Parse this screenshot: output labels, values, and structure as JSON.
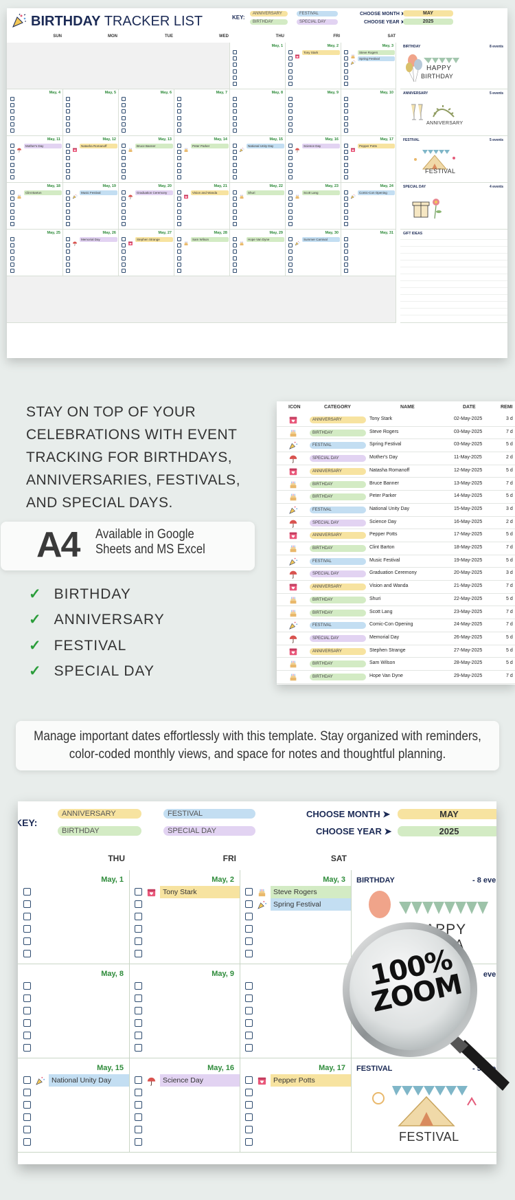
{
  "sheet1": {
    "title_bold": "BIRTHDAY",
    "title_rest": " TRACKER LIST",
    "key_label": "KEY:",
    "key": {
      "anniversary": "ANNIVERSARY",
      "festival": "FESTIVAL",
      "birthday": "BIRTHDAY",
      "special_day": "SPECIAL DAY"
    },
    "choose_month_label": "CHOOSE MONTH ➤",
    "choose_year_label": "CHOOSE YEAR ➤",
    "month": "MAY",
    "year": "2025",
    "day_headers": [
      "SUN",
      "MON",
      "TUE",
      "WED",
      "THU",
      "FRI",
      "SAT"
    ],
    "sidebar": [
      {
        "label": "BIRTHDAY",
        "count": "8 events"
      },
      {
        "label": "ANNIVERSARY",
        "count": "5 events"
      },
      {
        "label": "FESTIVAL",
        "count": "5 events"
      },
      {
        "label": "SPECIAL DAY",
        "count": "4 events"
      },
      {
        "label": "GIFT IDEAS",
        "count": ""
      }
    ],
    "art_text": {
      "happy": "HAPPY",
      "birthday": "BIRTHDAY",
      "anniversary": "ANNIVERSARY",
      "festival": "FESTIVAL"
    },
    "weeks": [
      [
        null,
        null,
        null,
        null,
        {
          "date": "May, 1",
          "events": []
        },
        {
          "date": "May, 2",
          "events": [
            {
              "name": "Tony Stark",
              "cat": "anniversary"
            }
          ]
        },
        {
          "date": "May, 3",
          "events": [
            {
              "name": "Steve Rogers",
              "cat": "birthday"
            },
            {
              "name": "Spring Festival",
              "cat": "festival"
            }
          ]
        }
      ],
      [
        {
          "date": "May, 4",
          "events": []
        },
        {
          "date": "May, 5",
          "events": []
        },
        {
          "date": "May, 6",
          "events": []
        },
        {
          "date": "May, 7",
          "events": []
        },
        {
          "date": "May, 8",
          "events": []
        },
        {
          "date": "May, 9",
          "events": []
        },
        {
          "date": "May, 10",
          "events": []
        }
      ],
      [
        {
          "date": "May, 11",
          "events": [
            {
              "name": "Mother's Day",
              "cat": "special"
            }
          ]
        },
        {
          "date": "May, 12",
          "events": [
            {
              "name": "Natasha Romanoff",
              "cat": "anniversary"
            }
          ]
        },
        {
          "date": "May, 13",
          "events": [
            {
              "name": "Bruce Banner",
              "cat": "birthday"
            }
          ]
        },
        {
          "date": "May, 14",
          "events": [
            {
              "name": "Peter Parker",
              "cat": "birthday"
            }
          ]
        },
        {
          "date": "May, 15",
          "events": [
            {
              "name": "National Unity Day",
              "cat": "festival"
            }
          ]
        },
        {
          "date": "May, 16",
          "events": [
            {
              "name": "Science Day",
              "cat": "special"
            }
          ]
        },
        {
          "date": "May, 17",
          "events": [
            {
              "name": "Pepper Potts",
              "cat": "anniversary"
            }
          ]
        }
      ],
      [
        {
          "date": "May, 18",
          "events": [
            {
              "name": "Clint Barton",
              "cat": "birthday"
            }
          ]
        },
        {
          "date": "May, 19",
          "events": [
            {
              "name": "Music Festival",
              "cat": "festival"
            }
          ]
        },
        {
          "date": "May, 20",
          "events": [
            {
              "name": "Graduation Ceremony",
              "cat": "special"
            }
          ]
        },
        {
          "date": "May, 21",
          "events": [
            {
              "name": "Vision and Wanda",
              "cat": "anniversary"
            }
          ]
        },
        {
          "date": "May, 22",
          "events": [
            {
              "name": "Shuri",
              "cat": "birthday"
            }
          ]
        },
        {
          "date": "May, 23",
          "events": [
            {
              "name": "Scott Lang",
              "cat": "birthday"
            }
          ]
        },
        {
          "date": "May, 24",
          "events": [
            {
              "name": "Comic-Con Opening",
              "cat": "festival"
            }
          ]
        }
      ],
      [
        {
          "date": "May, 25",
          "events": []
        },
        {
          "date": "May, 26",
          "events": [
            {
              "name": "Memorial Day",
              "cat": "special"
            }
          ]
        },
        {
          "date": "May, 27",
          "events": [
            {
              "name": "Stephen Strange",
              "cat": "anniversary"
            }
          ]
        },
        {
          "date": "May, 28",
          "events": [
            {
              "name": "Sam Wilson",
              "cat": "birthday"
            }
          ]
        },
        {
          "date": "May, 29",
          "events": [
            {
              "name": "Hope Van Dyne",
              "cat": "birthday"
            }
          ]
        },
        {
          "date": "May, 30",
          "events": [
            {
              "name": "Summer Carnival",
              "cat": "festival"
            }
          ]
        },
        {
          "date": "May, 31",
          "events": []
        }
      ],
      [
        null,
        null,
        null,
        null,
        null,
        null,
        null
      ]
    ]
  },
  "promo": {
    "headline_lines": [
      "STAY ON TOP OF YOUR",
      "CELEBRATIONS WITH EVENT",
      "TRACKING FOR BIRTHDAYS,",
      "ANNIVERSARIES, FESTIVALS,",
      "AND SPECIAL DAYS."
    ],
    "paper_size": "A4",
    "availability": "Available in Google Sheets and MS Excel",
    "checklist": [
      "BIRTHDAY",
      "ANNIVERSARY",
      "FESTIVAL",
      "SPECIAL DAY"
    ],
    "check_glyph": "✓"
  },
  "table": {
    "headers": {
      "icon": "ICON",
      "category": "CATEGORY",
      "name": "NAME",
      "date": "DATE",
      "reminder": "REMI"
    },
    "rows": [
      {
        "cat": "anniversary",
        "category": "ANNIVERSARY",
        "name": "Tony Stark",
        "date": "02-May-2025",
        "rem": "3 d"
      },
      {
        "cat": "birthday",
        "category": "BIRTHDAY",
        "name": "Steve Rogers",
        "date": "03-May-2025",
        "rem": "7 d"
      },
      {
        "cat": "festival",
        "category": "FESTIVAL",
        "name": "Spring Festival",
        "date": "03-May-2025",
        "rem": "5 d"
      },
      {
        "cat": "special",
        "category": "SPECIAL DAY",
        "name": "Mother's Day",
        "date": "11-May-2025",
        "rem": "2 d"
      },
      {
        "cat": "anniversary",
        "category": "ANNIVERSARY",
        "name": "Natasha Romanoff",
        "date": "12-May-2025",
        "rem": "5 d"
      },
      {
        "cat": "birthday",
        "category": "BIRTHDAY",
        "name": "Bruce Banner",
        "date": "13-May-2025",
        "rem": "7 d"
      },
      {
        "cat": "birthday",
        "category": "BIRTHDAY",
        "name": "Peter Parker",
        "date": "14-May-2025",
        "rem": "5 d"
      },
      {
        "cat": "festival",
        "category": "FESTIVAL",
        "name": "National Unity Day",
        "date": "15-May-2025",
        "rem": "3 d"
      },
      {
        "cat": "special",
        "category": "SPECIAL DAY",
        "name": "Science Day",
        "date": "16-May-2025",
        "rem": "2 d"
      },
      {
        "cat": "anniversary",
        "category": "ANNIVERSARY",
        "name": "Pepper Potts",
        "date": "17-May-2025",
        "rem": "5 d"
      },
      {
        "cat": "birthday",
        "category": "BIRTHDAY",
        "name": "Clint Barton",
        "date": "18-May-2025",
        "rem": "7 d"
      },
      {
        "cat": "festival",
        "category": "FESTIVAL",
        "name": "Music Festival",
        "date": "19-May-2025",
        "rem": "5 d"
      },
      {
        "cat": "special",
        "category": "SPECIAL DAY",
        "name": "Graduation Ceremony",
        "date": "20-May-2025",
        "rem": "3 d"
      },
      {
        "cat": "anniversary",
        "category": "ANNIVERSARY",
        "name": "Vision and Wanda",
        "date": "21-May-2025",
        "rem": "7 d"
      },
      {
        "cat": "birthday",
        "category": "BIRTHDAY",
        "name": "Shuri",
        "date": "22-May-2025",
        "rem": "5 d"
      },
      {
        "cat": "birthday",
        "category": "BIRTHDAY",
        "name": "Scott Lang",
        "date": "23-May-2025",
        "rem": "7 d"
      },
      {
        "cat": "festival",
        "category": "FESTIVAL",
        "name": "Comic-Con Opening",
        "date": "24-May-2025",
        "rem": "7 d"
      },
      {
        "cat": "special",
        "category": "SPECIAL DAY",
        "name": "Memorial Day",
        "date": "26-May-2025",
        "rem": "5 d"
      },
      {
        "cat": "anniversary",
        "category": "ANNIVERSARY",
        "name": "Stephen Strange",
        "date": "27-May-2025",
        "rem": "5 d"
      },
      {
        "cat": "birthday",
        "category": "BIRTHDAY",
        "name": "Sam Wilson",
        "date": "28-May-2025",
        "rem": "5 d"
      },
      {
        "cat": "birthday",
        "category": "BIRTHDAY",
        "name": "Hope Van Dyne",
        "date": "29-May-2025",
        "rem": "7 d"
      }
    ]
  },
  "description": "Manage important dates effortlessly with this template. Stay organized with reminders, color-coded monthly views, and space for notes and thoughtful planning.",
  "zoom": {
    "key_label": "KEY:",
    "choose_month_label": "CHOOSE MONTH ➤",
    "choose_year_label": "CHOOSE YEAR ➤",
    "month": "MAY",
    "year": "2025",
    "key": {
      "anniversary": "ANNIVERSARY",
      "festival": "FESTIVAL",
      "birthday": "BIRTHDAY",
      "special_day": "SPECIAL DAY"
    },
    "day_headers": [
      "THU",
      "FRI",
      "SAT"
    ],
    "sidebar": [
      {
        "label": "BIRTHDAY",
        "count": "-    8 even"
      },
      {
        "label": "ANNIVERSARY",
        "count": "even"
      },
      {
        "label": "FESTIVAL",
        "count": "-    5 even"
      }
    ],
    "art_text": {
      "happy": "HAPPY",
      "birthday": "BIRTHDA",
      "anniversary": "ANNIVERSARY",
      "festival": "FESTIVAL"
    },
    "weeks": [
      [
        {
          "date": "May, 1",
          "events": []
        },
        {
          "date": "May, 2",
          "events": [
            {
              "name": "Tony Stark",
              "cat": "anniversary"
            }
          ]
        },
        {
          "date": "May, 3",
          "events": [
            {
              "name": "Steve Rogers",
              "cat": "birthday"
            },
            {
              "name": "Spring Festival",
              "cat": "festival"
            }
          ]
        }
      ],
      [
        {
          "date": "May, 8",
          "events": []
        },
        {
          "date": "May, 9",
          "events": []
        },
        {
          "date": "",
          "events": []
        }
      ],
      [
        {
          "date": "May, 15",
          "events": [
            {
              "name": "National Unity Day",
              "cat": "festival"
            }
          ]
        },
        {
          "date": "May, 16",
          "events": [
            {
              "name": "Science Day",
              "cat": "special"
            }
          ]
        },
        {
          "date": "May, 17",
          "events": [
            {
              "name": "Pepper Potts",
              "cat": "anniversary"
            }
          ]
        }
      ]
    ],
    "magnifier_label": "100% ZOOM"
  },
  "colors": {
    "anniversary": "#f7e3a0",
    "birthday": "#d3ebc4",
    "festival": "#c3def2",
    "special": "#e2d3f2",
    "date_green": "#2e8b3a",
    "navy": "#1b2a55",
    "check_green": "#2a9d3a"
  }
}
